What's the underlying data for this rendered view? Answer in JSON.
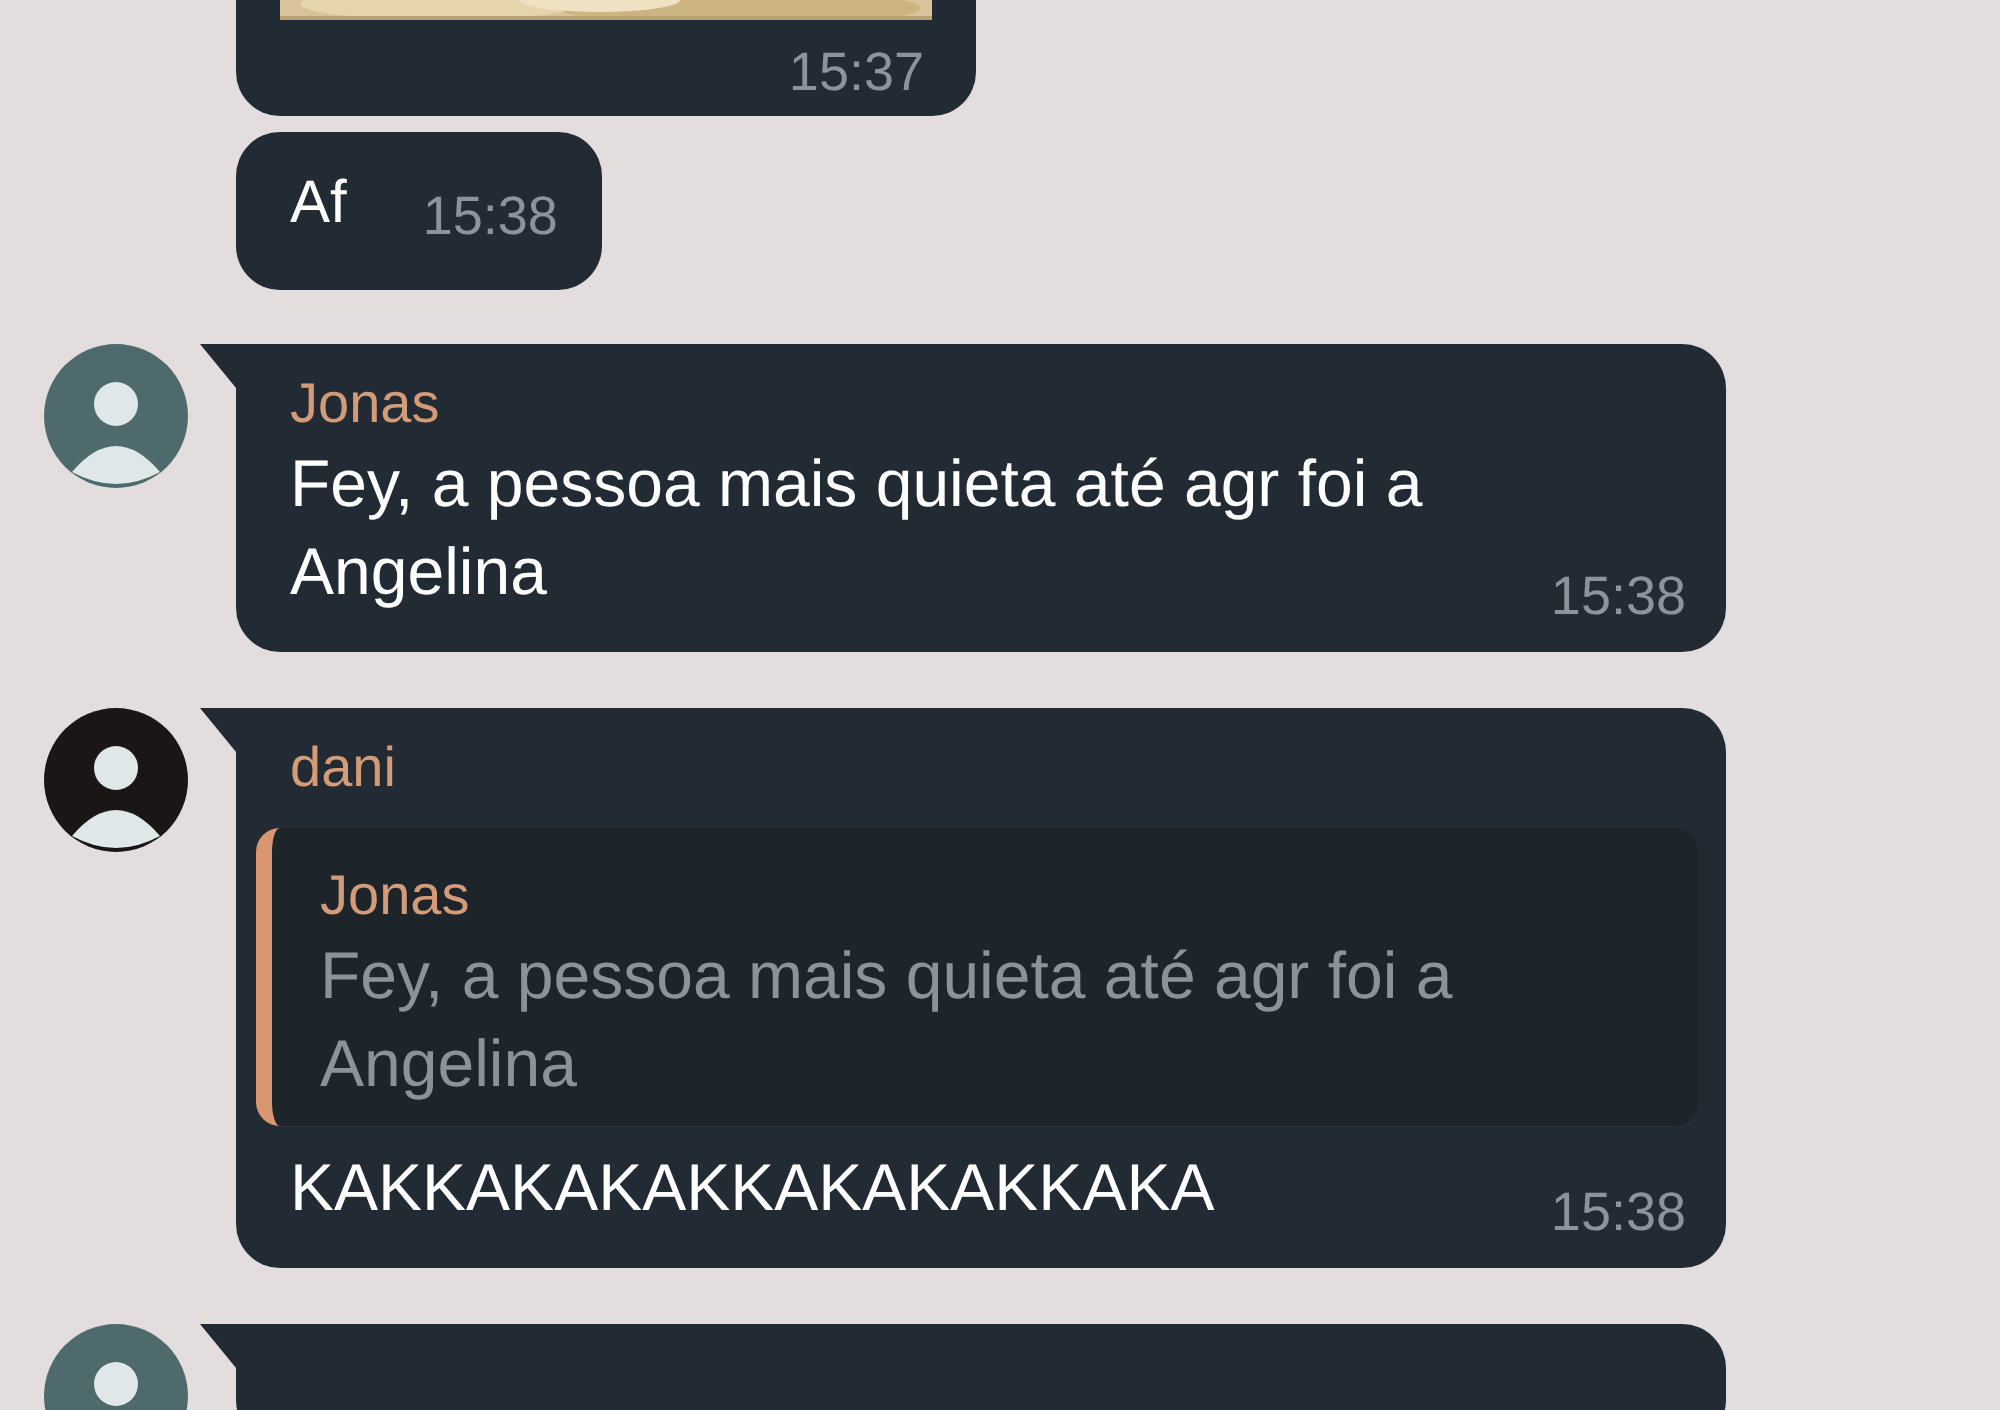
{
  "messages": [
    {
      "time": "15:37"
    },
    {
      "kind": "text",
      "text": "Af",
      "time": "15:38"
    },
    {
      "kind": "text",
      "sender": "Jonas",
      "color": "#4f6a6c",
      "text": "Fey, a pessoa mais quieta até agr foi a Angelina",
      "time": "15:38"
    },
    {
      "kind": "reply",
      "sender": "dani",
      "color": "#1b1616",
      "reply_to": {
        "sender": "Jonas",
        "text": "Fey, a pessoa mais quieta até agr foi a Angelina"
      },
      "text": "KAKKAKAKAKKAKAKAKKAKA",
      "time": "15:38"
    },
    {
      "kind": "partial",
      "color": "#4f6a6c"
    }
  ]
}
